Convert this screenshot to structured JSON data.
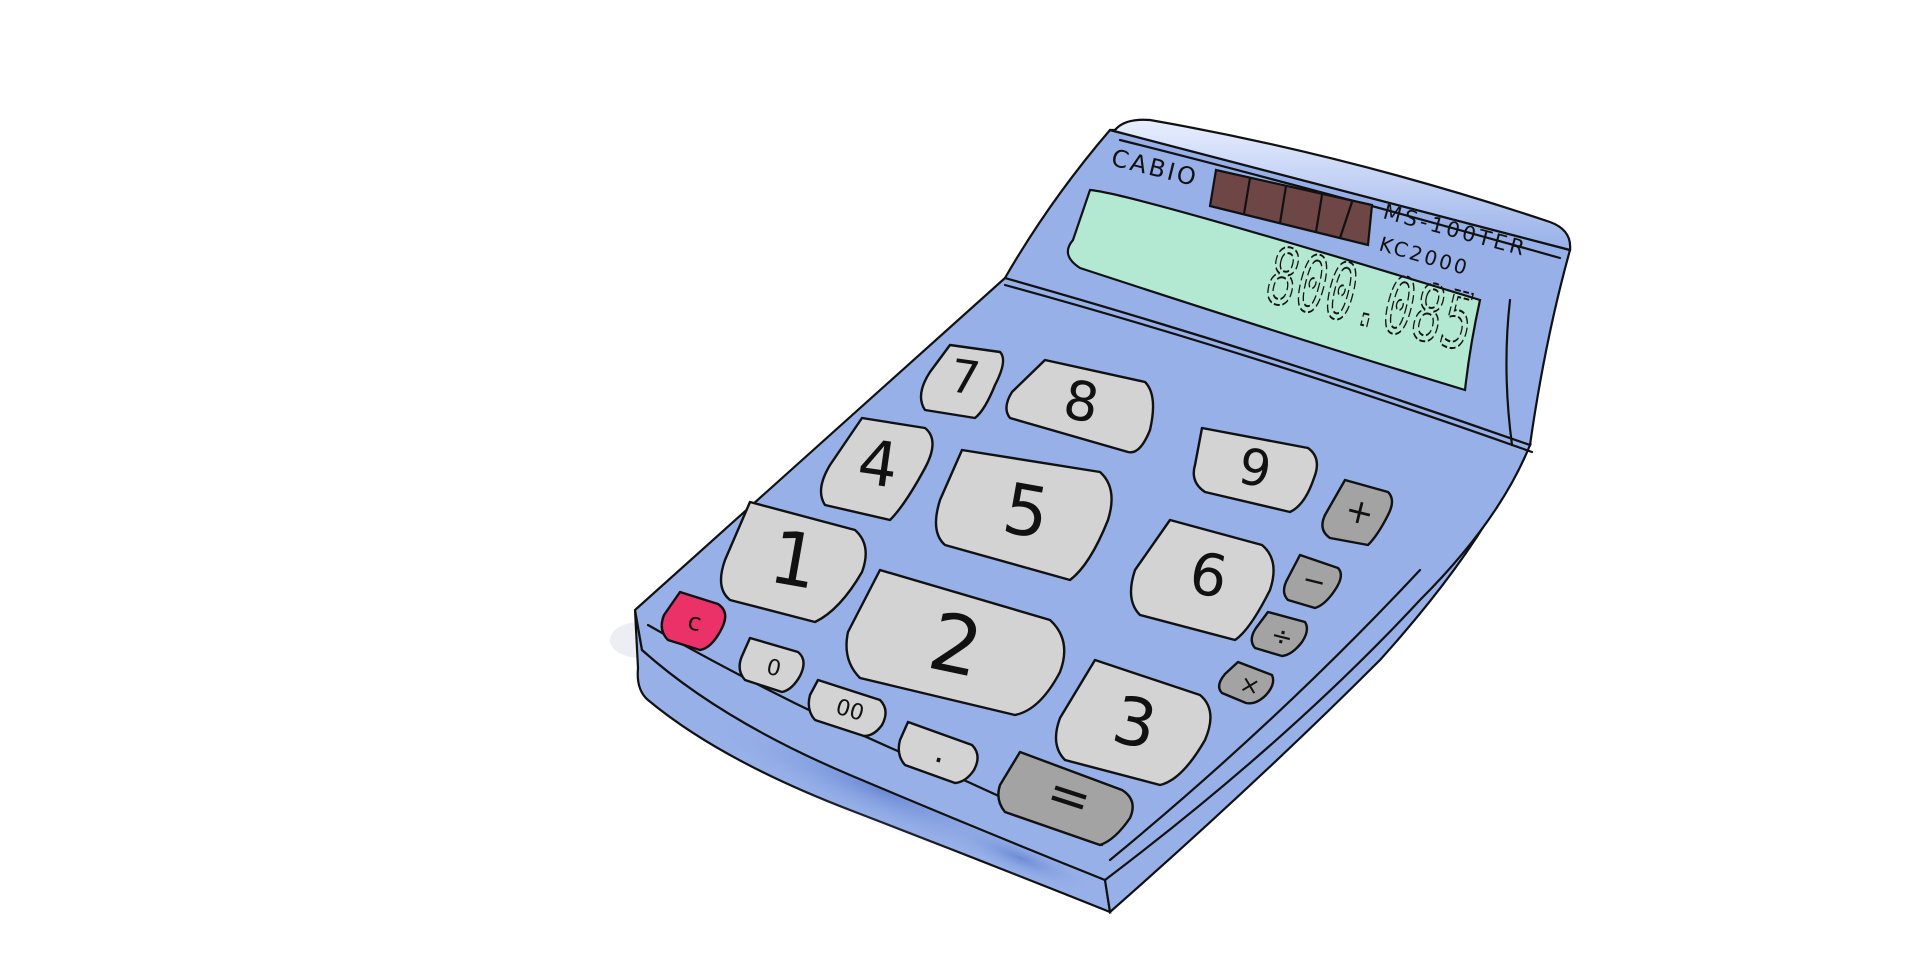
{
  "calculator": {
    "brand": "CABIO",
    "model_line1": "MS-100TER",
    "model_line2": "KC2000",
    "display_value": "800.085",
    "colors": {
      "body": "#97b0e8",
      "display": "#b3e8d2",
      "key": "#d3d3d3",
      "operator_key": "#a3a3a3",
      "clear_key": "#ea3168",
      "solar_panel": "#6e4645"
    },
    "keys": {
      "seven": "7",
      "eight": "8",
      "nine": "9",
      "four": "4",
      "five": "5",
      "six": "6",
      "one": "1",
      "two": "2",
      "three": "3",
      "zero": "0",
      "double_zero": "00",
      "decimal": ".",
      "clear": "c",
      "equals": "=",
      "plus": "+",
      "minus": "−",
      "divide": "÷",
      "multiply": "×"
    }
  }
}
